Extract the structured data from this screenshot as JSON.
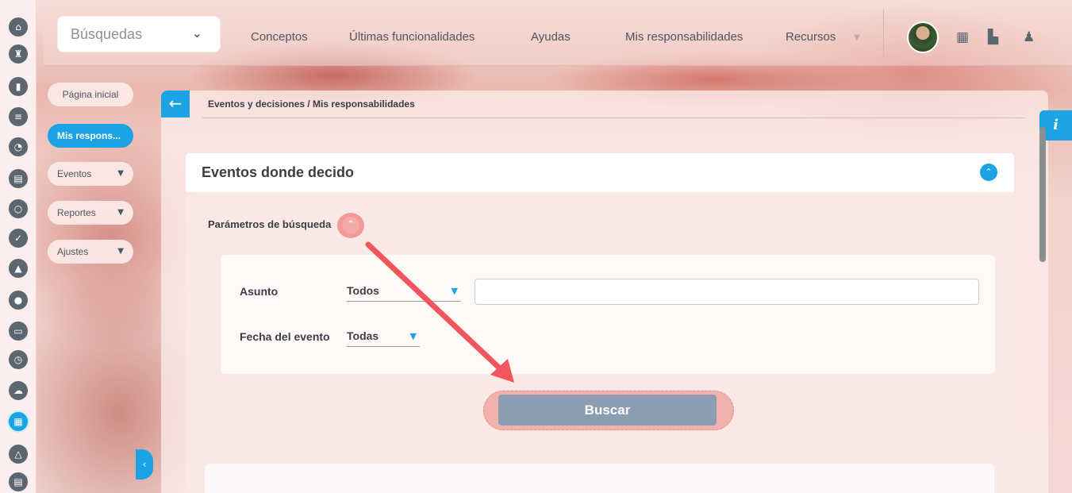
{
  "topbar": {
    "search_label": "Búsquedas",
    "nav": [
      "Conceptos",
      "Últimas funcionalidades",
      "Ayudas",
      "Mis responsabilidades",
      "Recursos"
    ]
  },
  "side_menu": {
    "items": [
      {
        "label": "Página inicial"
      },
      {
        "label": "Mis respons..."
      },
      {
        "label": "Eventos"
      },
      {
        "label": "Reportes"
      },
      {
        "label": "Ajustes"
      }
    ]
  },
  "breadcrumb": "Eventos y decisiones / Mis responsabilidades",
  "card": {
    "title": "Eventos donde decido",
    "params_label": "Parámetros de búsqueda",
    "asunto_label": "Asunto",
    "asunto_value": "Todos",
    "fecha_label": "Fecha del evento",
    "fecha_value": "Todas",
    "search_button": "Buscar"
  },
  "colors": {
    "accent": "#1ba3e5",
    "annotation_arrow": "#f0565b",
    "button": "#8c9db2"
  },
  "icons": {
    "rail": [
      "home-icon",
      "tower-icon",
      "chart-icon",
      "list-icon",
      "pie-icon",
      "document-icon",
      "circle-icon",
      "check-icon",
      "warning-icon",
      "toggle-icon",
      "monitor-icon",
      "clock-icon",
      "cloud-icon",
      "calendar-icon",
      "network-icon",
      "report-icon"
    ],
    "top": [
      "calendar-icon",
      "map-icon",
      "bell-icon"
    ]
  }
}
